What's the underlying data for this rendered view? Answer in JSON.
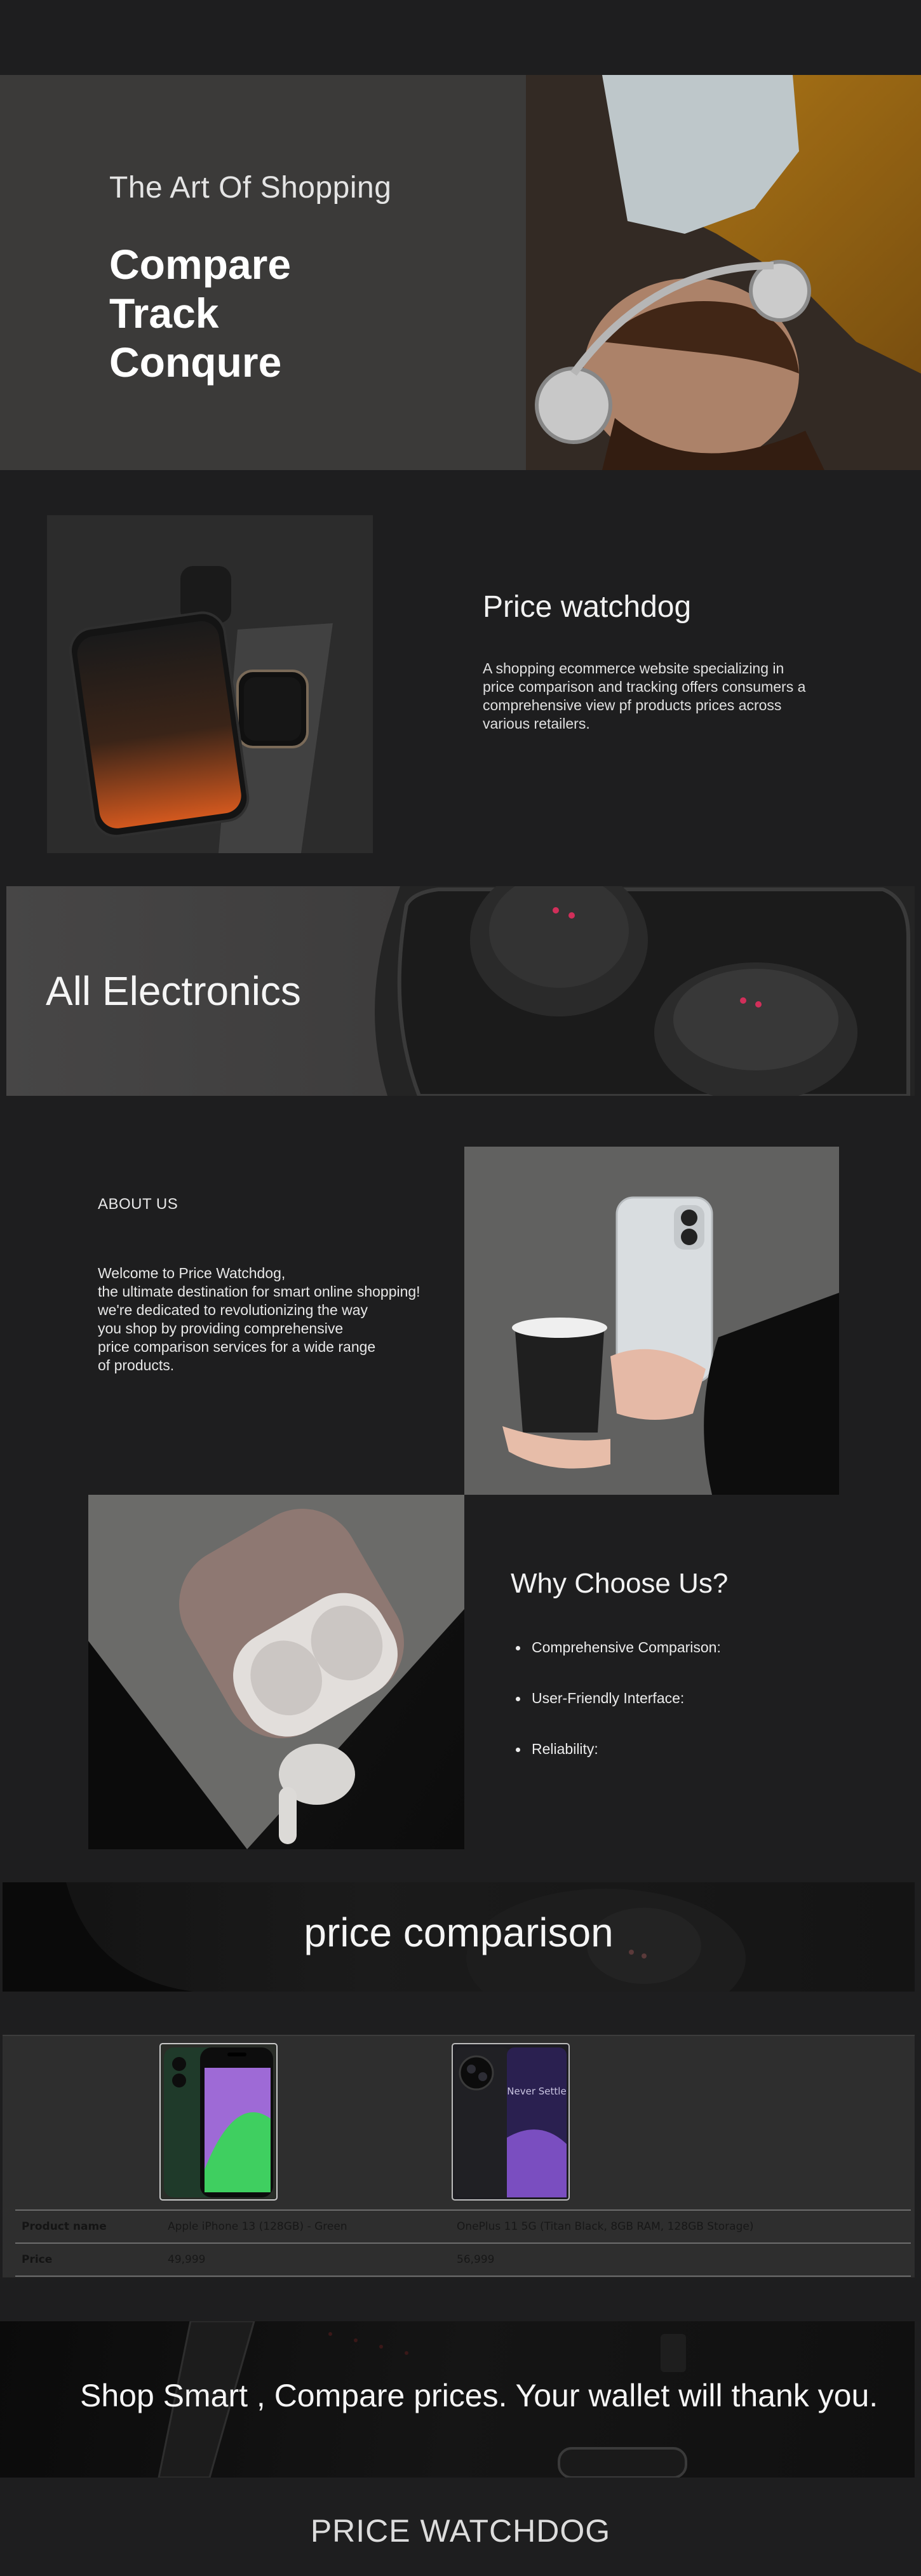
{
  "hero": {
    "tagline": "The Art Of Shopping",
    "headline": [
      "Compare",
      "Track",
      "Conqure"
    ]
  },
  "watchdog": {
    "title": "Price watchdog",
    "description": "A shopping ecommerce website specializing in price comparison and tracking offers consumers a comprehensive view pf products prices across various retailers."
  },
  "electronics": {
    "title": "All Electronics"
  },
  "about": {
    "label": "ABOUT US",
    "lines": [
      "Welcome to Price Watchdog,",
      "the ultimate destination for smart online shopping!",
      "we're dedicated to revolutionizing the way",
      "you shop by providing comprehensive",
      "price comparison services for a wide range",
      "of products."
    ]
  },
  "why": {
    "title": "Why Choose Us?",
    "items": [
      "Comprehensive Comparison:",
      "User-Friendly Interface:",
      "Reliability:"
    ]
  },
  "comparison": {
    "banner_title": "price comparison",
    "phone1_screen_text": "",
    "phone2_screen_text": "Never Settle",
    "rows": [
      {
        "label": "Product name",
        "p1": "Apple iPhone 13 (128GB) - Green",
        "p2": "OnePlus 11 5G (Titan Black, 8GB RAM, 128GB Storage)"
      },
      {
        "label": "Price",
        "p1": "49,999",
        "p2": "56,999"
      }
    ]
  },
  "smart": {
    "slogan": "Shop Smart , Compare prices. Your wallet will thank you."
  },
  "footer": {
    "brand": "PRICE WATCHDOG"
  }
}
